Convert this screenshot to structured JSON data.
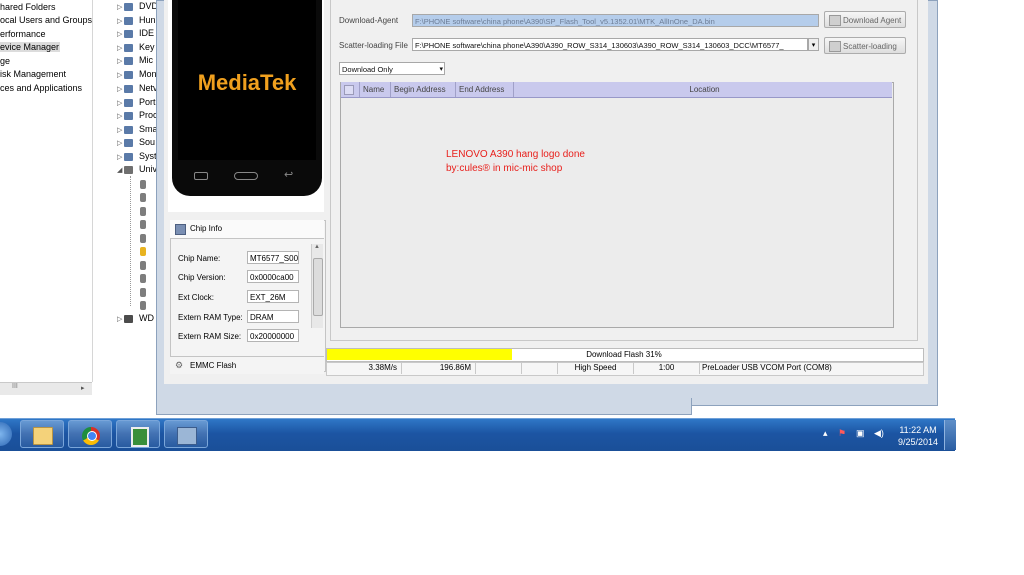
{
  "computer_management": {
    "left_tree": [
      {
        "label": "hared Folders"
      },
      {
        "label": "ocal Users and Groups"
      },
      {
        "label": "erformance"
      },
      {
        "label": "evice Manager",
        "selected": true
      },
      {
        "label": "ge"
      },
      {
        "label": "isk Management"
      },
      {
        "label": "ces and Applications"
      }
    ],
    "device_tree": [
      "DVD",
      "Hun",
      "IDE",
      "Key",
      "Mic",
      "Mon",
      "Netv",
      "Port",
      "Proc",
      "Sma",
      "Sou",
      "Syst",
      "Univ"
    ],
    "device_tree_last": "WD",
    "scroll_glyph": "III"
  },
  "flash_tool": {
    "brand_logo": "MediaTek",
    "download_agent": {
      "label": "Download-Agent",
      "value": "F:\\PHONE software\\china phone\\A390\\SP_Flash_Tool_v5.1352.01\\MTK_AllInOne_DA.bin",
      "button": "Download Agent"
    },
    "scatter": {
      "label": "Scatter-loading File",
      "value": "F:\\PHONE software\\china phone\\A390\\A390_ROW_S314_130603\\A390_ROW_S314_130603_DCC\\MT6577_",
      "button": "Scatter-loading"
    },
    "mode_select": "Download Only",
    "table_headers": [
      "Name",
      "Begin Address",
      "End Address",
      "Location"
    ],
    "note_lines": [
      "LENOVO A390 hang logo done",
      "by:cules® in mic-mic shop"
    ],
    "chip_info": {
      "title": "Chip Info",
      "rows": [
        {
          "label": "Chip Name:",
          "value": "MT6577_S00"
        },
        {
          "label": "Chip Version:",
          "value": "0x0000ca00"
        },
        {
          "label": "Ext Clock:",
          "value": "EXT_26M"
        },
        {
          "label": "Extern RAM Type:",
          "value": "DRAM"
        },
        {
          "label": "Extern RAM Size:",
          "value": "0x20000000"
        }
      ]
    },
    "emmc_label": "EMMC Flash",
    "progress": {
      "label": "Download Flash 31%",
      "fraction": 0.31
    },
    "status": {
      "speed": "3.38M/s",
      "size": "196.86M",
      "mode": "High Speed",
      "time": "1:00",
      "port": "PreLoader USB VCOM Port (COM8)"
    }
  },
  "taskbar": {
    "apps": [
      "explorer-icon",
      "chrome-icon",
      "flash-tool-icon",
      "network-admin-icon"
    ],
    "time": "11:22 AM",
    "date": "9/25/2014",
    "colors": {
      "accent": "#1c55a3",
      "progress_fill": "#ffff00",
      "note_text": "#e8201c",
      "table_header": "#c9c9ed"
    }
  }
}
